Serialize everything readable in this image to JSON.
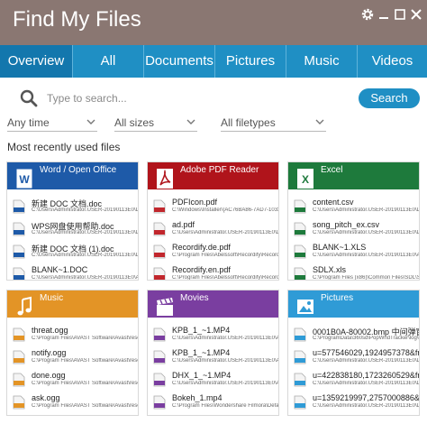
{
  "window": {
    "title": "Find My Files",
    "controls": [
      "gear-icon",
      "minimize-icon",
      "maximize-icon",
      "close-icon"
    ]
  },
  "tabs": [
    {
      "label": "Overview",
      "active": true
    },
    {
      "label": "All"
    },
    {
      "label": "Documents"
    },
    {
      "label": "Pictures"
    },
    {
      "label": "Music"
    },
    {
      "label": "Videos"
    }
  ],
  "search": {
    "placeholder": "Type to search...",
    "button_label": "Search"
  },
  "filters": {
    "time": "Any time",
    "size": "All sizes",
    "filetype": "All filetypes"
  },
  "recent_title": "Most recently used files",
  "colors": {
    "titlebar": "#8a7772",
    "tabbar": "#1f8fc4",
    "word": "#1e5aa8",
    "pdf": "#b0141b",
    "excel": "#1e7a3c",
    "music": "#e39426",
    "movies": "#7a3ea0",
    "pictures": "#2f9bd6"
  },
  "cards": [
    {
      "name": "Word / Open Office",
      "icon": "word-icon",
      "files": [
        {
          "name": "新建 DOC 文档.doc",
          "path": "C:\\Users\\Administrator.USER-20190113E0\\Desk...",
          "icon": "doc-file-icon",
          "ext": "DOC"
        },
        {
          "name": "WPS网盘使用帮助.doc",
          "path": "C:\\Users\\Administrator.USER-20190113E0\\Desk...",
          "icon": "doc-file-icon",
          "ext": "DOC"
        },
        {
          "name": "新建 DOC 文档 (1).doc",
          "path": "C:\\Users\\Administrator.USER-20190113E0\\Desk...",
          "icon": "doc-file-icon",
          "ext": "DOC"
        },
        {
          "name": "BLANK~1.DOC",
          "path": "C:\\Users\\Administrator.USER-20190113E0\\AppD...",
          "icon": "doc-file-icon",
          "ext": "DOC"
        }
      ]
    },
    {
      "name": "Adobe PDF Reader",
      "icon": "pdf-icon",
      "files": [
        {
          "name": "PDFIcon.pdf",
          "path": "C:\\Windows\\Installer\\{AC76BA86-7AD7-1033-7B44...",
          "icon": "pdf-file-icon",
          "ext": "PDF"
        },
        {
          "name": "ad.pdf",
          "path": "C:\\Users\\Administrator.USER-20190113E0\\Desk...",
          "icon": "pdf-file-icon",
          "ext": "PDF"
        },
        {
          "name": "Recordify.de.pdf",
          "path": "C:\\Program Files\\Abelssoft\\Recordify\\Recordif...",
          "icon": "pdf-file-icon",
          "ext": "PDF"
        },
        {
          "name": "Recordify.en.pdf",
          "path": "C:\\Program Files\\Abelssoft\\Recordify\\Recordif...",
          "icon": "pdf-file-icon",
          "ext": "PDF"
        }
      ]
    },
    {
      "name": "Excel",
      "icon": "excel-icon",
      "files": [
        {
          "name": "content.csv",
          "path": "C:\\Users\\Administrator.USER-20190113E0\\Desk...",
          "icon": "csv-file-icon",
          "ext": "CSV"
        },
        {
          "name": "song_pitch_ex.csv",
          "path": "C:\\Users\\Administrator.USER-20190113E0\\Desk...",
          "icon": "csv-file-icon",
          "ext": "CSV"
        },
        {
          "name": "BLANK~1.XLS",
          "path": "C:\\Users\\Administrator.USER-20190113E0\\AppD...",
          "icon": "xls-file-icon",
          "ext": "XLS"
        },
        {
          "name": "SDLX.xls",
          "path": "C:\\Program Files (x86)\\Common Files\\SDL\\SDL...",
          "icon": "xls-file-icon",
          "ext": "XLS"
        }
      ]
    },
    {
      "name": "Music",
      "icon": "music-note-icon",
      "files": [
        {
          "name": "threat.ogg",
          "path": "C:\\Program Files\\AVAST Software\\Avast\\resour...",
          "icon": "audio-file-icon",
          "ext": "OGG"
        },
        {
          "name": "notify.ogg",
          "path": "C:\\Program Files\\AVAST Software\\Avast\\resour...",
          "icon": "audio-file-icon",
          "ext": "OGG"
        },
        {
          "name": "done.ogg",
          "path": "C:\\Program Files\\AVAST Software\\Avast\\resour...",
          "icon": "audio-file-icon",
          "ext": "OGG"
        },
        {
          "name": "ask.ogg",
          "path": "C:\\Program Files\\AVAST Software\\Avast\\resour...",
          "icon": "audio-file-icon",
          "ext": "OGG"
        }
      ]
    },
    {
      "name": "Movies",
      "icon": "clapperboard-icon",
      "files": [
        {
          "name": "KPB_1_~1.MP4",
          "path": "C:\\Users\\Administrator.USER-20190113E0\\AppD...",
          "icon": "video-file-icon",
          "ext": "MP4"
        },
        {
          "name": "KPB_1_~1.MP4",
          "path": "C:\\Users\\Administrator.USER-20190113E0\\AppD...",
          "icon": "video-file-icon",
          "ext": "MP4"
        },
        {
          "name": "DHX_1_~1.MP4",
          "path": "C:\\Users\\Administrator.USER-20190113E0\\AppD...",
          "icon": "video-file-icon",
          "ext": "MP4"
        },
        {
          "name": "Bokeh_1.mp4",
          "path": "C:\\Program Files\\Wondershare Filmora\\Default...",
          "icon": "video-file-icon",
          "ext": "MP4"
        }
      ]
    },
    {
      "name": "Pictures",
      "icon": "picture-icon",
      "files": [
        {
          "name": "0001B0A-80002.bmp 中间弹窗.bmp",
          "path": "C:\\ProgramData\\360sd\\PopWndTracker\\log\\0...",
          "icon": "image-file-icon",
          "ext": "BMP"
        },
        {
          "name": "u=577546029,1924957378&fm=2...",
          "path": "C:\\Users\\Administrator.USER-20190113E0\\Desk...",
          "icon": "image-file-icon",
          "ext": "JPG"
        },
        {
          "name": "u=422838180,1723260529&fm=2...",
          "path": "C:\\Users\\Administrator.USER-20190113E0\\Desk...",
          "icon": "image-file-icon",
          "ext": "JPG"
        },
        {
          "name": "u=1359219997,2757000886&fm...",
          "path": "C:\\Users\\Administrator.USER-20190113E0\\Desk...",
          "icon": "image-file-icon",
          "ext": "JPG"
        }
      ]
    }
  ]
}
